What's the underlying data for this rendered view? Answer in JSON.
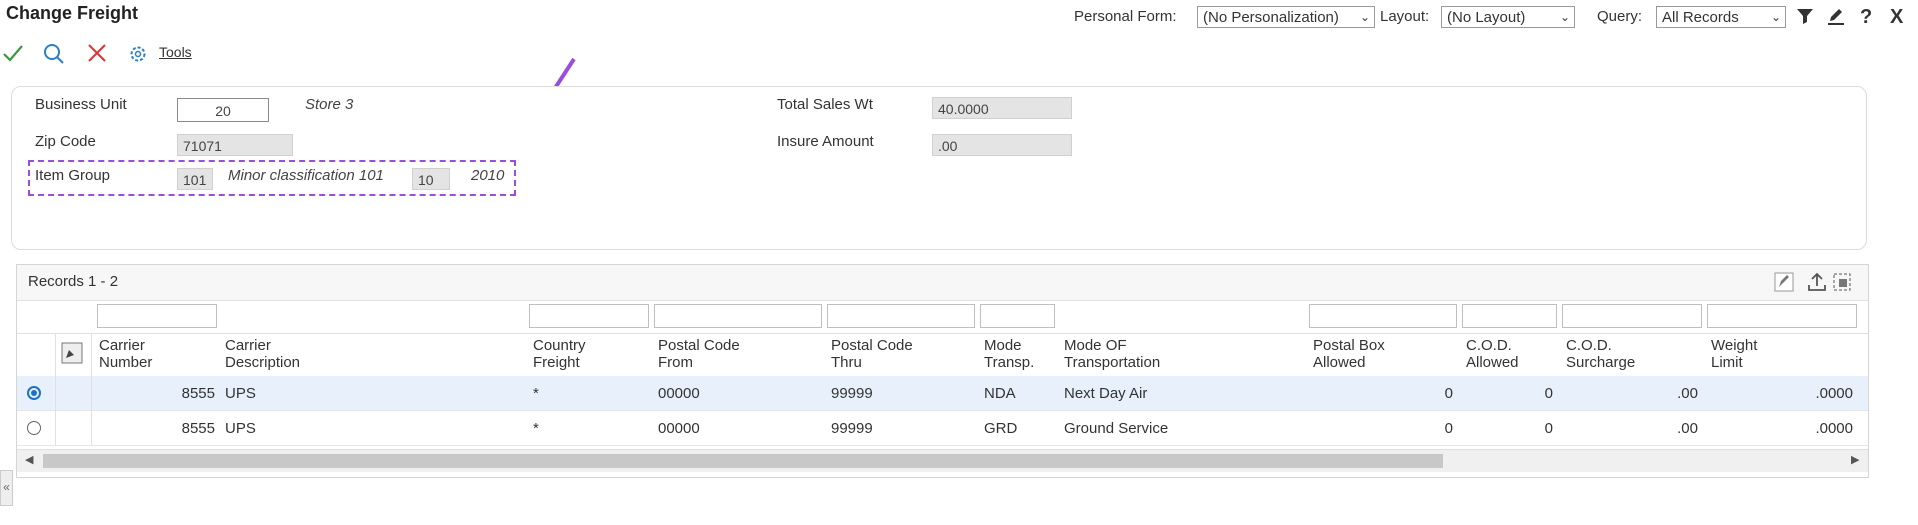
{
  "app": {
    "title": "Change Freight"
  },
  "header": {
    "personal_form_label": "Personal Form:",
    "personal_form_value": "(No Personalization)",
    "layout_label": "Layout:",
    "layout_value": "(No Layout)",
    "query_label": "Query:",
    "query_value": "All Records"
  },
  "toolbar": {
    "tools_label": "Tools"
  },
  "form": {
    "business_unit_label": "Business Unit",
    "business_unit_value": "20",
    "business_unit_desc": "Store 3",
    "zip_code_label": "Zip Code",
    "zip_code_value": "71071",
    "item_group_label": "Item Group",
    "item_group_code": "101",
    "item_group_desc": "Minor classification 101",
    "item_group_sub": "10",
    "item_group_year": "2010",
    "total_sales_wt_label": "Total Sales Wt",
    "total_sales_wt_value": "40.0000",
    "insure_amount_label": "Insure Amount",
    "insure_amount_value": ".00"
  },
  "grid": {
    "records_label": "Records 1 - 2",
    "columns": [
      [
        "Carrier",
        "Number"
      ],
      [
        "Carrier",
        "Description"
      ],
      [
        "Country",
        "Freight"
      ],
      [
        "Postal Code",
        "From"
      ],
      [
        "Postal Code",
        "Thru"
      ],
      [
        "Mode",
        "Transp."
      ],
      [
        "Mode OF",
        "Transportation"
      ],
      [
        "Postal Box",
        "Allowed"
      ],
      [
        "C.O.D.",
        "Allowed"
      ],
      [
        "C.O.D.",
        "Surcharge"
      ],
      [
        "Weight",
        "Limit"
      ]
    ],
    "rows": [
      {
        "carrier_number": "8555",
        "carrier_desc": "UPS",
        "country_freight": "*",
        "postal_from": "00000",
        "postal_thru": "99999",
        "mode_transp": "NDA",
        "mode_of_transport": "Next Day Air",
        "postal_box": "0",
        "cod_allowed": "0",
        "cod_surcharge": ".00",
        "weight_limit": ".0000",
        "selected": true
      },
      {
        "carrier_number": "8555",
        "carrier_desc": "UPS",
        "country_freight": "*",
        "postal_from": "00000",
        "postal_thru": "99999",
        "mode_transp": "GRD",
        "mode_of_transport": "Ground Service",
        "postal_box": "0",
        "cod_allowed": "0",
        "cod_surcharge": ".00",
        "weight_limit": ".0000",
        "selected": false
      }
    ]
  },
  "colors": {
    "accent": "#1a73c8",
    "annotation": "#9b4de0",
    "ok": "#3a9a3a",
    "cancel": "#d33",
    "selected_row": "#e8f1fb"
  }
}
